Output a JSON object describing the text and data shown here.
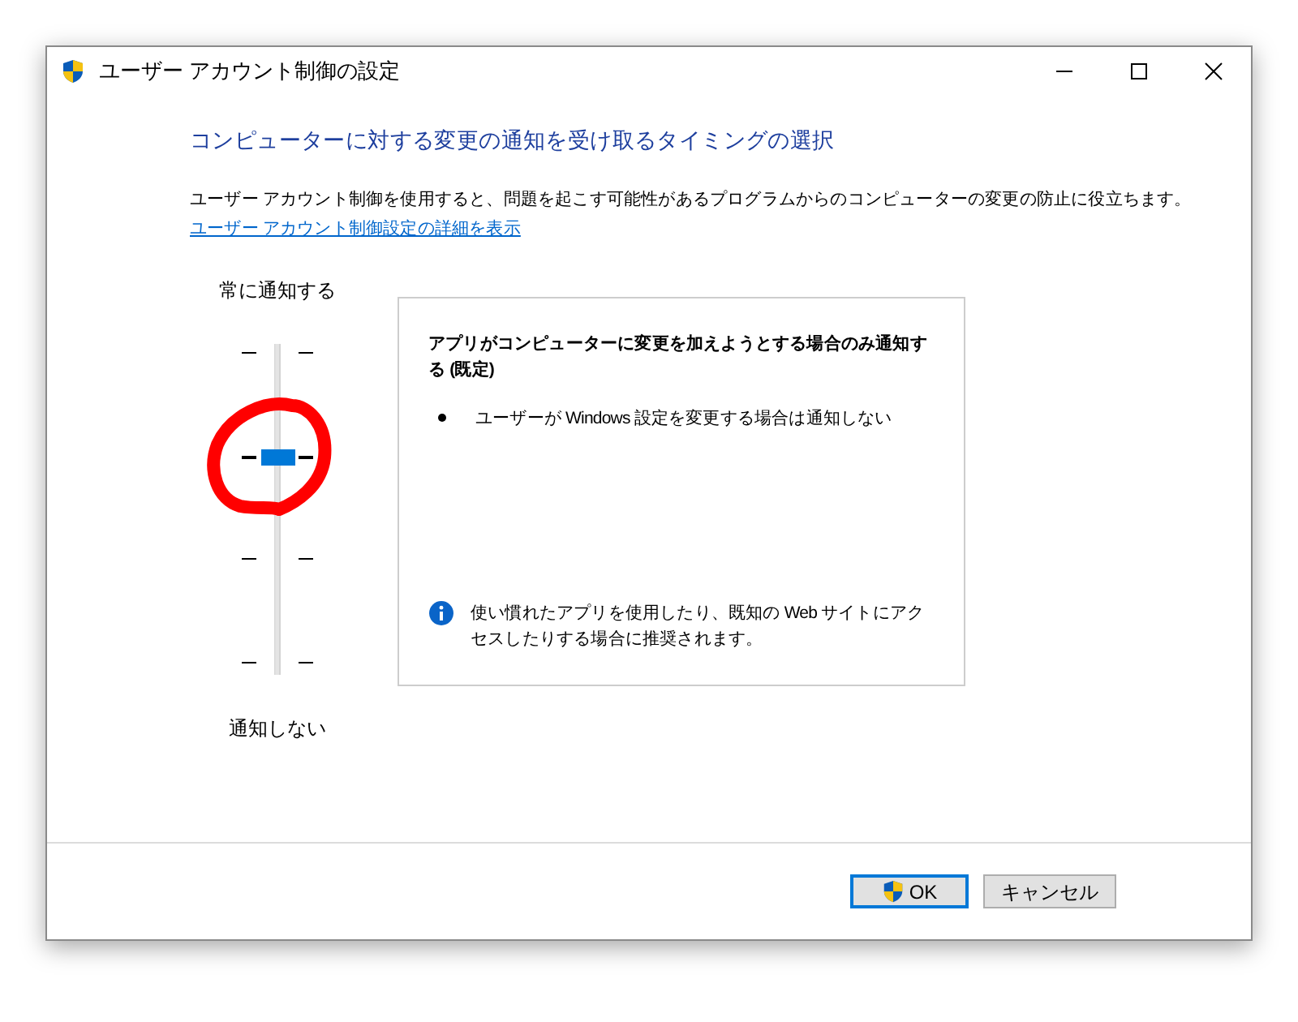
{
  "window": {
    "title": "ユーザー アカウント制御の設定"
  },
  "heading": "コンピューターに対する変更の通知を受け取るタイミングの選択",
  "description": "ユーザー アカウント制御を使用すると、問題を起こす可能性があるプログラムからのコンピューターの変更の防止に役立ちます。",
  "details_link": "ユーザー アカウント制御設定の詳細を表示",
  "slider": {
    "top_label": "常に通知する",
    "bottom_label": "通知しない",
    "level": 0.6667
  },
  "annotation": {
    "kind": "circle"
  },
  "info_panel": {
    "title": "アプリがコンピューターに変更を加えようとする場合のみ通知する (既定)",
    "bullets": [
      "ユーザーが Windows 設定を変更する場合は通知しない"
    ],
    "note": "使い慣れたアプリを使用したり、既知の Web サイトにアクセスしたりする場合に推奨されます。"
  },
  "buttons": [
    {
      "label": "OK",
      "kind": "shield",
      "default": true
    },
    {
      "label": "キャンセル",
      "kind": "plain",
      "default": false
    }
  ]
}
